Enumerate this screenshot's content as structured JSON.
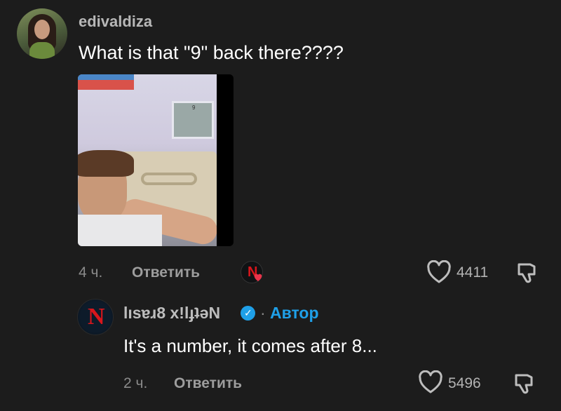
{
  "comment": {
    "username": "edivaldiza",
    "text": "What is that \"9\" back there????",
    "photo_door_number": "9",
    "time": "4 ч.",
    "reply_label": "Ответить",
    "likes": "4411"
  },
  "reply": {
    "username": "lısɐɹ8 x!lɟʇəN",
    "separator": "·",
    "author_tag": "Автор",
    "text": "It's a number, it comes after 8...",
    "time": "2 ч.",
    "reply_label": "Ответить",
    "likes": "5496"
  },
  "colors": {
    "background": "#1c1c1c",
    "author_accent": "#1fa0e8",
    "netflix_red": "#d8161c",
    "heart_badge": "#e8344a"
  },
  "icons": {
    "like": "heart-outline-icon",
    "dislike": "thumbs-down-icon",
    "verified": "verified-check-icon",
    "creator_like": "creator-liked-heart-icon"
  }
}
